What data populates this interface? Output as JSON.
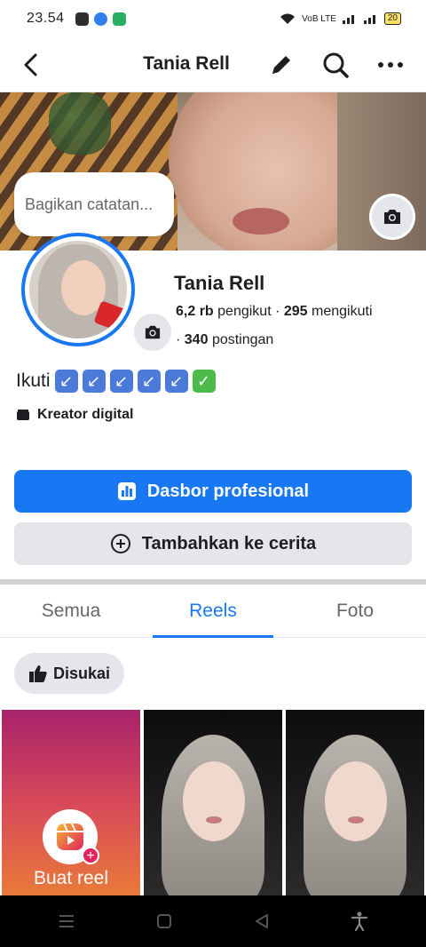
{
  "status_bar": {
    "time": "23.54",
    "network": "VoB LTE",
    "battery": "20"
  },
  "header": {
    "title": "Tania Rell"
  },
  "note": {
    "placeholder": "Bagikan catatan..."
  },
  "profile": {
    "name": "Tania Rell",
    "followers_count": "6,2 rb",
    "followers_label": "pengikut",
    "separator": "·",
    "following_count": "295",
    "following_label": "mengikuti",
    "posts_count": "340",
    "posts_label": "postingan",
    "bio_text": "Ikuti",
    "bio_emojis": [
      "↙",
      "↙",
      "↙",
      "↙",
      "↙",
      "✓"
    ],
    "category": "Kreator digital"
  },
  "buttons": {
    "dashboard_label": "Dasbor profesional",
    "add_story_label": "Tambahkan ke cerita"
  },
  "tabs": [
    {
      "label": "Semua",
      "active": false
    },
    {
      "label": "Reels",
      "active": true
    },
    {
      "label": "Foto",
      "active": false
    }
  ],
  "filter_chip": {
    "label": "Disukai"
  },
  "reels": {
    "create_label": "Buat reel"
  },
  "colors": {
    "accent": "#1877f2",
    "secondary_button": "#e4e6eb",
    "text": "#1c1e21",
    "muted": "#65676b"
  },
  "icons": [
    "back-arrow-icon",
    "pencil-icon",
    "search-icon",
    "more-icon",
    "camera-icon",
    "dashboard-icon",
    "add-circle-icon",
    "thumbs-up-icon",
    "reels-icon",
    "clapperboard-icon"
  ]
}
